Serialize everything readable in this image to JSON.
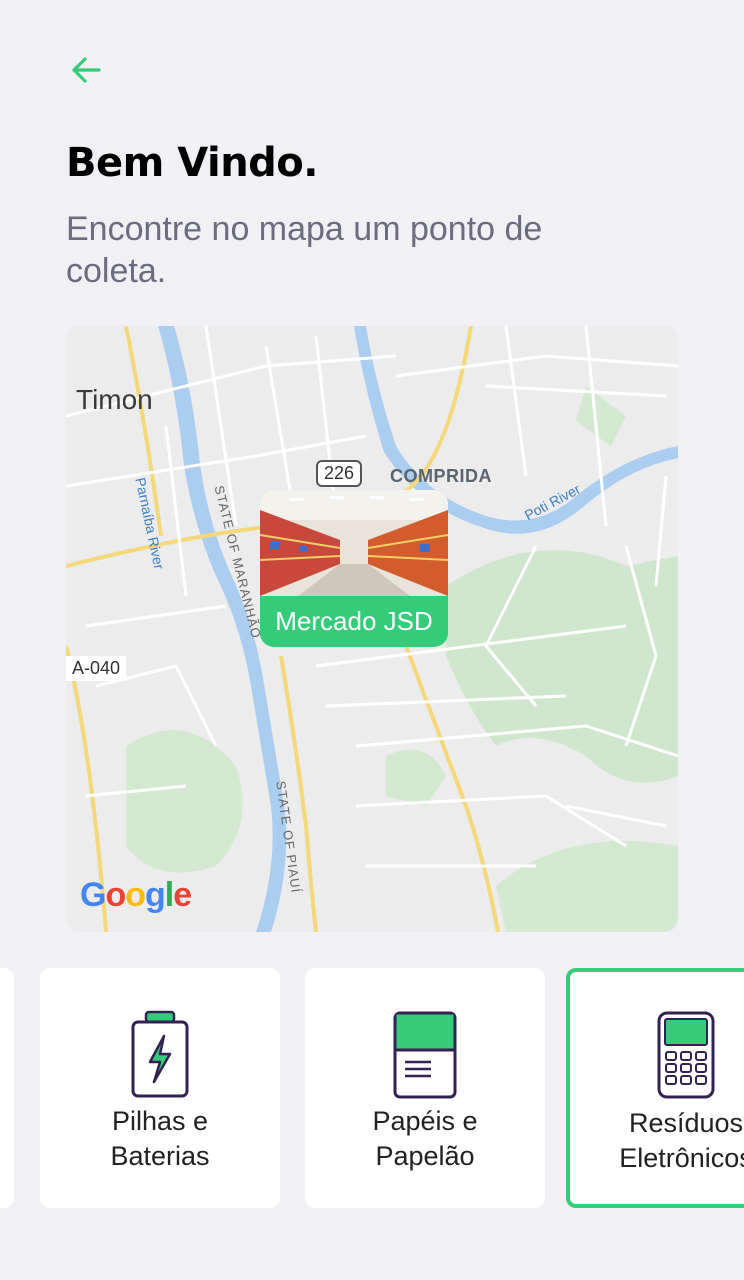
{
  "header": {
    "title": "Bem Vindo.",
    "subtitle": "Encontre no mapa um ponto de coleta."
  },
  "map": {
    "labels": {
      "city": "Timon",
      "highway": "226",
      "neighborhood": "COMPRIDA",
      "river_poti": "Poti River",
      "river_parnaiba": "Parnaíba River",
      "state_maranhao": "STATE OF MARANHÃO",
      "state_piaui": "STATE OF PIAUÍ",
      "road_tag": "A-040"
    },
    "marker": {
      "name": "Mercado JSD"
    },
    "attribution": "Google"
  },
  "categories": [
    {
      "label_line1": "Pilhas e",
      "label_line2": "Baterias",
      "icon": "battery-icon",
      "selected": false
    },
    {
      "label_line1": "Papéis e",
      "label_line2": "Papelão",
      "icon": "paper-icon",
      "selected": false
    },
    {
      "label_line1": "Resíduos",
      "label_line2": "Eletrônicos",
      "icon": "electronics-icon",
      "selected": true
    }
  ],
  "colors": {
    "accent": "#34cb79",
    "background": "#f0f0f5",
    "title": "#000000",
    "subtitle": "#6c6c80",
    "icon_stroke": "#322153"
  }
}
